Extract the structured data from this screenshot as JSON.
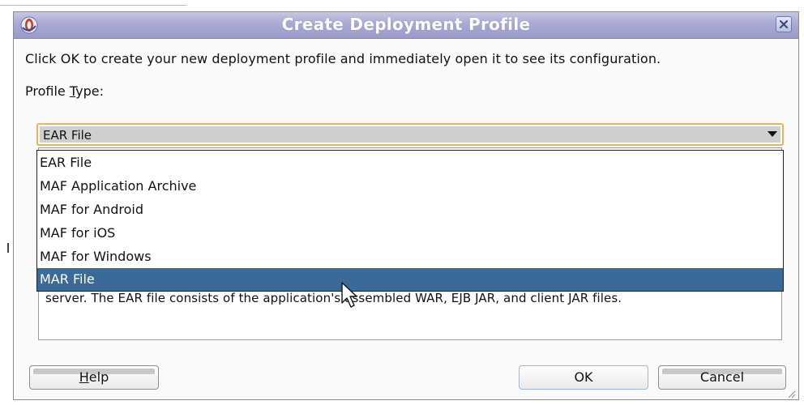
{
  "dialog": {
    "title": "Create Deployment Profile",
    "logo_icon": "oracle-logo-icon",
    "close_icon": "close-icon"
  },
  "content": {
    "intro_text": "Click OK to create your new deployment profile and immediately open it to see its configuration.",
    "profile_type_label_pre": "Profile ",
    "profile_type_label_mnemonic": "T",
    "profile_type_label_post": "ype:"
  },
  "profile_type": {
    "selected": "EAR File",
    "options": [
      {
        "label": "EAR File"
      },
      {
        "label": "MAF Application Archive"
      },
      {
        "label": "MAF for Android"
      },
      {
        "label": "MAF for iOS"
      },
      {
        "label": "MAF for Windows"
      },
      {
        "label": "MAR File",
        "highlighted": true
      }
    ]
  },
  "description": {
    "visible_line": "server.  The EAR file consists of the application's assembled WAR, EJB JAR, and client JAR files."
  },
  "buttons": {
    "help_mnemonic": "H",
    "help_rest": "elp",
    "ok": "OK",
    "cancel": "Cancel"
  },
  "colors": {
    "title_bar": "#a9a9d3",
    "selection": "#3a6a97",
    "combo_focus": "#e7b35b"
  }
}
